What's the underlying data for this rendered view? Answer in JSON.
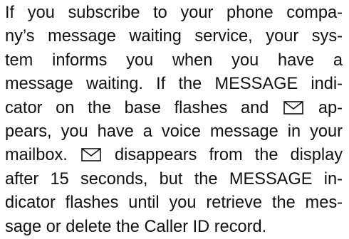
{
  "paragraph": {
    "lines": [
      "If you subscribe to your phone compa-",
      "ny’s message waiting service, your sys-",
      "tem informs you when you have a",
      "message waiting. If the MESSAGE indi-",
      "cator on the base flashes and",
      "ap-",
      "pears, you have a voice message in your",
      "mailbox.",
      "disappears from the display",
      "after 15 seconds, but the MESSAGE in-",
      "dicator flashes until you retrieve the mes-",
      "sage or delete the Caller ID record."
    ]
  },
  "icons": {
    "message_envelope": "envelope-icon"
  }
}
